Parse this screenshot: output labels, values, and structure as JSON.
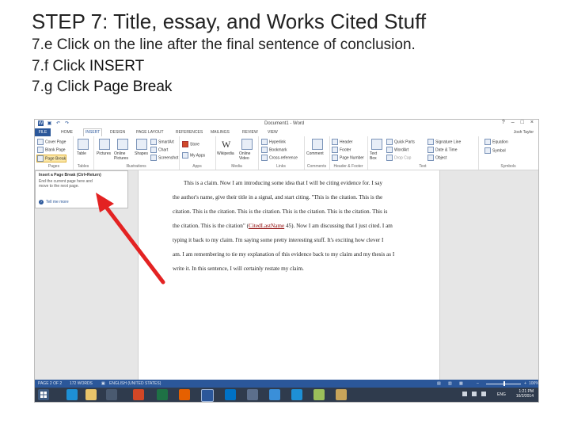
{
  "slide": {
    "title": "STEP 7: Title, essay, and Works Cited Stuff",
    "step_e": "7.e Click on the line after the final sentence of conclusion.",
    "step_f_prefix": "7.f Click ",
    "step_f_action": "INSERT",
    "step_g_prefix": "7.g Click ",
    "step_g_action": "Page Break"
  },
  "word": {
    "doc_title": "Document1 - Word",
    "user": "Josh Taylor",
    "tabs": [
      "FILE",
      "HOME",
      "INSERT",
      "DESIGN",
      "PAGE LAYOUT",
      "REFERENCES",
      "MAILINGS",
      "REVIEW",
      "VIEW"
    ],
    "active_tab": "INSERT",
    "ribbon": {
      "pages": {
        "cover_page": "Cover Page",
        "blank_page": "Blank Page",
        "page_break": "Page Break",
        "label": "Pages"
      },
      "tables": {
        "table": "Table",
        "label": "Tables"
      },
      "illustrations": {
        "pictures": "Pictures",
        "online_pictures": "Online Pictures",
        "shapes": "Shapes",
        "smartart": "SmartArt",
        "chart": "Chart",
        "screenshot": "Screenshot",
        "label": "Illustrations"
      },
      "apps": {
        "store": "Store",
        "my_apps": "My Apps",
        "label": "Apps"
      },
      "media": {
        "wikipedia": "Wikipedia",
        "online_video": "Online Video",
        "label": "Media"
      },
      "links": {
        "hyperlink": "Hyperlink",
        "bookmark": "Bookmark",
        "cross_reference": "Cross-reference",
        "label": "Links"
      },
      "comments": {
        "comment": "Comment",
        "label": "Comments"
      },
      "header_footer": {
        "header": "Header",
        "footer": "Footer",
        "page_number": "Page Number",
        "label": "Header & Footer"
      },
      "text": {
        "text_box": "Text Box",
        "quick_parts": "Quick Parts",
        "wordart": "WordArt",
        "drop_cap": "Drop Cap",
        "signature_line": "Signature Line",
        "date_time": "Date & Time",
        "object": "Object",
        "label": "Text"
      },
      "symbols": {
        "equation": "Equation",
        "symbol": "Symbol",
        "label": "Symbols"
      }
    },
    "tooltip": {
      "title": "Insert a Page Break (Ctrl+Return)",
      "desc_1": "End the current page here and",
      "desc_2": "move to the next page.",
      "help": "Tell me more"
    },
    "document_lines": [
      "This is a claim. Now I am introducing some idea that I will be citing evidence for. I say",
      "the author's name, give their title in a signal, and start citing. \"This is the citation. This is the",
      "citation. This is the citation. This is the citation. This is the citation. This is the citation. This is",
      "the citation. This is the citation\" (",
      "CitedLastName",
      " 45). Now I am discussing that I just cited. I am",
      "typing it back to my claim. I'm saying some pretty interesting stuff. It's exciting how clever I",
      "am. I am remembering to tie my explanation of this evidence back to my claim and my thesis as I",
      "write it. In this sentence, I will certainly restate my claim."
    ],
    "status": {
      "page": "PAGE 2 OF 2",
      "words": "172 WORDS",
      "language": "ENGLISH (UNITED STATES)",
      "zoom": "100%"
    },
    "taskbar": {
      "lang": "ENG",
      "time": "1:21 PM",
      "date": "10/2/2014"
    }
  },
  "colors": {
    "word_blue": "#2b579a",
    "arrow_red": "#e32222",
    "taskbar": "#2f3b4d"
  }
}
